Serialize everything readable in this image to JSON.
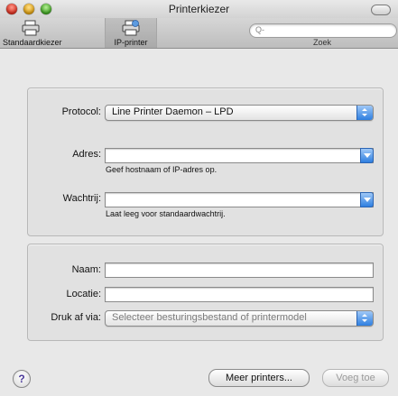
{
  "window": {
    "title": "Printerkiezer"
  },
  "toolbar": {
    "default_label": "Standaardkiezer",
    "ip_label": "IP-printer",
    "search_label": "Zoek",
    "search_placeholder": "Q-"
  },
  "connection": {
    "protocol_label": "Protocol:",
    "protocol_value": "Line Printer Daemon – LPD",
    "address_label": "Adres:",
    "address_value": "",
    "address_hint": "Geef hostnaam of IP-adres op.",
    "queue_label": "Wachtrij:",
    "queue_value": "",
    "queue_hint": "Laat leeg voor standaardwachtrij."
  },
  "printer": {
    "name_label": "Naam:",
    "name_value": "",
    "location_label": "Locatie:",
    "location_value": "",
    "print_via_label": "Druk af via:",
    "print_via_value": "Selecteer besturingsbestand of printermodel"
  },
  "footer": {
    "help_label": "?",
    "more_printers_label": "Meer printers...",
    "add_label": "Voeg toe"
  },
  "colors": {
    "accent": "#2e7fe0",
    "window_bg": "#e8e8e8"
  },
  "icons": [
    "printer-icon",
    "ip-printer-icon",
    "search-icon",
    "chevron-down-icon",
    "stepper-icon",
    "help-icon"
  ]
}
